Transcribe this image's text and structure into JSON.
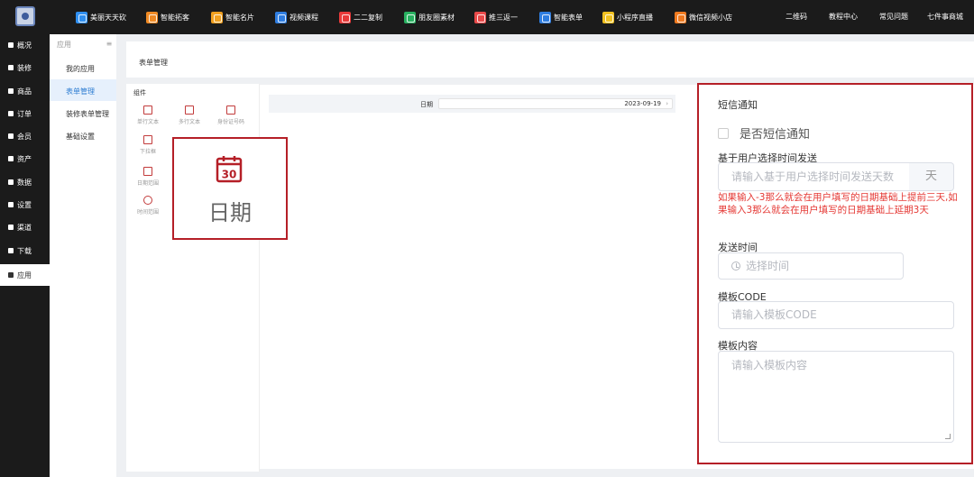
{
  "topbar": {
    "nav": [
      {
        "label": "美丽天天砍",
        "color": "#2f8ff0"
      },
      {
        "label": "智能拓客",
        "color": "#f08a24"
      },
      {
        "label": "智能名片",
        "color": "#f0a020"
      },
      {
        "label": "视频课程",
        "color": "#2f7de0"
      },
      {
        "label": "二二复制",
        "color": "#e83a3a"
      },
      {
        "label": "朋友圈素材",
        "color": "#28b060"
      },
      {
        "label": "推三返一",
        "color": "#e84a4a"
      },
      {
        "label": "智能表单",
        "color": "#2f7de0"
      },
      {
        "label": "小程序直播",
        "color": "#f0c020"
      },
      {
        "label": "微信视频小店",
        "color": "#f07a20"
      }
    ],
    "right": [
      "二维码",
      "教程中心",
      "常见问题",
      "七件事商城"
    ]
  },
  "leftnav": [
    {
      "label": "概况"
    },
    {
      "label": "装修"
    },
    {
      "label": "商品"
    },
    {
      "label": "订单"
    },
    {
      "label": "会员"
    },
    {
      "label": "资产"
    },
    {
      "label": "数据"
    },
    {
      "label": "设置"
    },
    {
      "label": "渠道"
    },
    {
      "label": "下载"
    },
    {
      "label": "应用"
    }
  ],
  "subnav": {
    "header": "应用",
    "toggle": "≡",
    "items": [
      "我的应用",
      "表单管理",
      "装修表单管理",
      "基础设置"
    ]
  },
  "page": {
    "title": "表单管理"
  },
  "widgets": {
    "header": "组件",
    "items": [
      "单行文本",
      "多行文本",
      "身份证号码",
      "下拉框",
      "日期范围",
      "时间范围"
    ]
  },
  "canvas": {
    "date_label": "日期",
    "date_value": "2023-09-19",
    "date_chevron": "›"
  },
  "highlight": {
    "calendar_number": "30",
    "label": "日期"
  },
  "sms": {
    "title": "短信通知",
    "checkbox_label": "是否短信通知",
    "days_label": "基于用户选择时间发送",
    "days_placeholder": "请输入基于用户选择时间发送天数",
    "days_unit": "天",
    "hint": "如果输入-3那么就会在用户填写的日期基础上提前三天,如果输入3那么就会在用户填写的日期基础上延期3天",
    "send_time_label": "发送时间",
    "send_time_placeholder": "选择时间",
    "template_code_label": "模板CODE",
    "template_code_placeholder": "请输入模板CODE",
    "template_content_label": "模板内容",
    "template_content_placeholder": "请输入模板内容"
  },
  "colors": {
    "highlight_border": "#b51f27",
    "accent": "#2d7dd2",
    "hint": "#e53935"
  }
}
